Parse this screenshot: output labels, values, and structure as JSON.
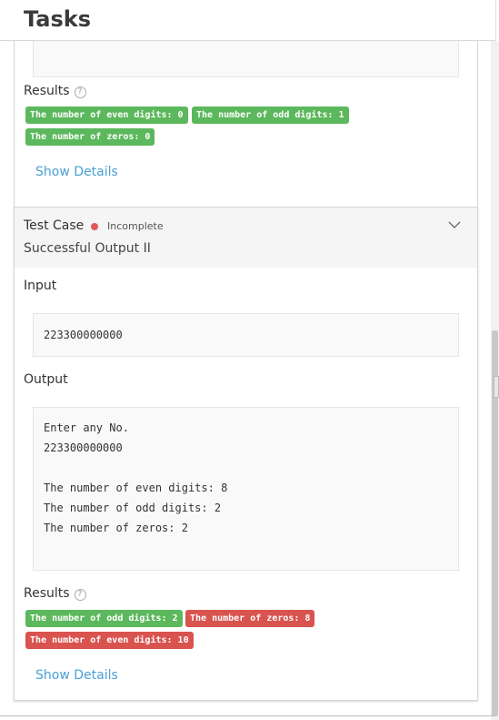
{
  "header": {
    "title": "Tasks"
  },
  "prev_case": {
    "results_label": "Results",
    "badges": [
      {
        "text": "The number of even digits: 0",
        "status": "pass"
      },
      {
        "text": "The number of odd digits: 1",
        "status": "pass"
      },
      {
        "text": "The number of zeros: 0",
        "status": "pass"
      }
    ],
    "show_details": "Show Details"
  },
  "test_case": {
    "label": "Test Case",
    "status": "Incomplete",
    "status_color": "#e05a5a",
    "name": "Successful Output II",
    "input_label": "Input",
    "input_value": "223300000000",
    "output_label": "Output",
    "output_lines": [
      "Enter any No.",
      "223300000000",
      "",
      "The number of even digits: 8",
      "The number of odd digits: 2",
      "The number of zeros: 2"
    ],
    "results_label": "Results",
    "badges": [
      {
        "text": "The number of odd digits: 2",
        "status": "pass"
      },
      {
        "text": "The number of zeros: 8",
        "status": "fail"
      },
      {
        "text": "The number of even digits: 10",
        "status": "fail"
      }
    ],
    "show_details": "Show Details"
  },
  "colors": {
    "pass": "#5cb85c",
    "fail": "#d9534f",
    "link": "#4a9fd5"
  }
}
